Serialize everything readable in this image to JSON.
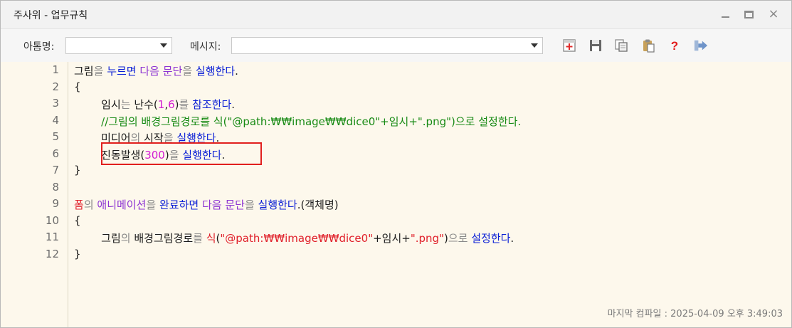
{
  "window": {
    "title": "주사위 - 업무규칙",
    "minimize_label": "minimize",
    "maximize_label": "maximize",
    "close_label": "×"
  },
  "toolbar": {
    "name_label": "아톰명:",
    "name_value": "",
    "message_label": "메시지:",
    "message_value": "",
    "icons": [
      "new-icon",
      "save-icon",
      "copy-icon",
      "paste-icon",
      "help-icon",
      "exit-icon"
    ]
  },
  "editor": {
    "line_numbers": [
      "1",
      "2",
      "3",
      "4",
      "5",
      "6",
      "7",
      "8",
      "9",
      "10",
      "11",
      "12"
    ],
    "lines": [
      [
        {
          "t": "그림"
        },
        {
          "t": "을 ",
          "c": "gry"
        },
        {
          "t": "누르면",
          "c": "kw"
        },
        {
          "t": " "
        },
        {
          "t": "다음 문단",
          "c": "pur"
        },
        {
          "t": "을 ",
          "c": "gry"
        },
        {
          "t": "실행한다",
          "c": "kw"
        },
        {
          "t": "."
        }
      ],
      [
        {
          "t": "{"
        }
      ],
      [
        {
          "t": "        임시"
        },
        {
          "t": "는 ",
          "c": "gry"
        },
        {
          "t": "난수("
        },
        {
          "t": "1",
          "c": "mag"
        },
        {
          "t": ","
        },
        {
          "t": "6",
          "c": "mag"
        },
        {
          "t": ")"
        },
        {
          "t": "를 ",
          "c": "gry"
        },
        {
          "t": "참조한다",
          "c": "kw"
        },
        {
          "t": "."
        }
      ],
      [
        {
          "t": "        //그림의 배경그림경로를 식(\"@path:₩₩image₩₩dice0\"+임시+\".png\")으로 설정한다.",
          "c": "grn"
        }
      ],
      [
        {
          "t": "        미디어"
        },
        {
          "t": "의 ",
          "c": "gry"
        },
        {
          "t": "시작"
        },
        {
          "t": "을 ",
          "c": "gry"
        },
        {
          "t": "실행한다",
          "c": "kw"
        },
        {
          "t": "."
        }
      ],
      [
        {
          "t": "        진동발생("
        },
        {
          "t": "300",
          "c": "mag"
        },
        {
          "t": ")"
        },
        {
          "t": "을 ",
          "c": "gry"
        },
        {
          "t": "실행한다",
          "c": "kw"
        },
        {
          "t": "."
        }
      ],
      [
        {
          "t": "}"
        }
      ],
      [
        {
          "t": ""
        }
      ],
      [
        {
          "t": "폼",
          "c": "red"
        },
        {
          "t": "의 ",
          "c": "gry"
        },
        {
          "t": "애니메이션",
          "c": "pur"
        },
        {
          "t": "을 ",
          "c": "gry"
        },
        {
          "t": "완료하면",
          "c": "kw"
        },
        {
          "t": " "
        },
        {
          "t": "다음 문단",
          "c": "pur"
        },
        {
          "t": "을 ",
          "c": "gry"
        },
        {
          "t": "실행한다",
          "c": "kw"
        },
        {
          "t": ".(객체명)"
        }
      ],
      [
        {
          "t": "{"
        }
      ],
      [
        {
          "t": "        그림"
        },
        {
          "t": "의 ",
          "c": "gry"
        },
        {
          "t": "배경그림경로"
        },
        {
          "t": "를 ",
          "c": "gry"
        },
        {
          "t": "식",
          "c": "red"
        },
        {
          "t": "("
        },
        {
          "t": "\"@path:₩₩image₩₩dice0\"",
          "c": "red"
        },
        {
          "t": "+임시+"
        },
        {
          "t": "\".png\"",
          "c": "red"
        },
        {
          "t": ")"
        },
        {
          "t": "으로 ",
          "c": "gry"
        },
        {
          "t": "설정한다",
          "c": "kw"
        },
        {
          "t": "."
        }
      ],
      [
        {
          "t": "}"
        }
      ]
    ]
  },
  "status": {
    "text": "마지막 컴파일 : 2025-04-09 오후 3:49:03"
  },
  "colors": {
    "keyword": "#0b1fd6",
    "paragraph": "#8c32d2",
    "comment": "#178a14",
    "particle": "#8a8a8a",
    "string": "#e0202a",
    "number": "#d21bd2",
    "highlight_box": "#e1201e",
    "editor_bg": "#fdf8ec"
  }
}
